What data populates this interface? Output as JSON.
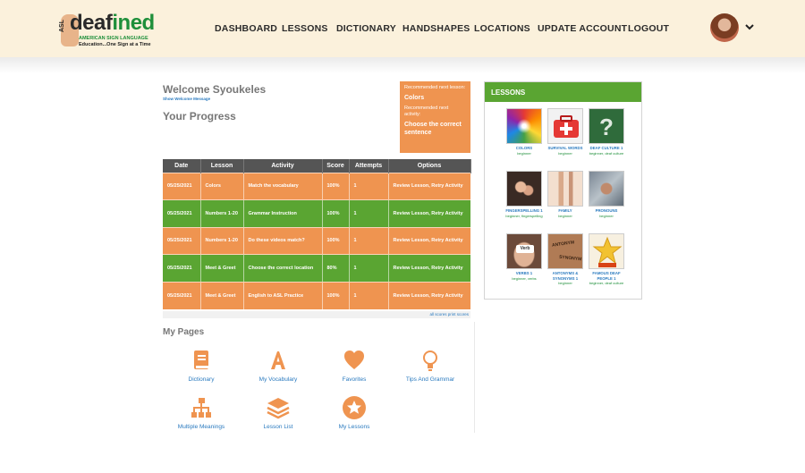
{
  "header": {
    "logo": {
      "asl": "ASL",
      "word_main": "deaf",
      "word_accent": "ined",
      "tagline1": "AMERICAN SIGN LANGUAGE",
      "tagline2": "Education...One Sign at a Time"
    },
    "nav": [
      "DASHBOARD",
      "LESSONS",
      "DICTIONARY",
      "HANDSHAPES",
      "LOCATIONS",
      "UPDATE ACCOUNT",
      "LOGOUT"
    ],
    "chevron": "⌄"
  },
  "welcome": {
    "title": "Welcome Syoukeles",
    "show_link": "Show Welcome Message",
    "progress_title": "Your Progress"
  },
  "recommend": {
    "lesson_label": "Recommended next lesson:",
    "lesson_value": "Colors",
    "activity_label": "Recommended next activity:",
    "activity_value": "Choose the correct sentence"
  },
  "table": {
    "headers": [
      "Date",
      "Lesson",
      "Activity",
      "Score",
      "Attempts",
      "Options"
    ],
    "rows": [
      {
        "date": "05/25/2021",
        "lesson": "Colors",
        "activity": "Match the vocabulary",
        "score": "100%",
        "attempts": "1",
        "options": "Review Lesson, Retry Activity"
      },
      {
        "date": "05/25/2021",
        "lesson": "Numbers 1-20",
        "activity": "Grammar Instruction",
        "score": "100%",
        "attempts": "1",
        "options": "Review Lesson, Retry Activity"
      },
      {
        "date": "05/25/2021",
        "lesson": "Numbers 1-20",
        "activity": "Do these videos match?",
        "score": "100%",
        "attempts": "1",
        "options": "Review Lesson, Retry Activity"
      },
      {
        "date": "05/25/2021",
        "lesson": "Meet & Greet",
        "activity": "Choose the correct location",
        "score": "80%",
        "attempts": "1",
        "options": "Review Lesson, Retry Activity"
      },
      {
        "date": "05/25/2021",
        "lesson": "Meet & Greet",
        "activity": "English to ASL Practice",
        "score": "100%",
        "attempts": "1",
        "options": "Review Lesson, Retry Activity"
      }
    ],
    "footer": "all scores   print scores"
  },
  "my_pages": {
    "title": "My Pages",
    "items": [
      {
        "label": "Dictionary",
        "icon": "book-icon"
      },
      {
        "label": "My Vocabulary",
        "icon": "letter-a-icon"
      },
      {
        "label": "Favorites",
        "icon": "heart-icon"
      },
      {
        "label": "Tips And Grammar",
        "icon": "lightbulb-icon"
      },
      {
        "label": "Multiple Meanings",
        "icon": "hierarchy-icon"
      },
      {
        "label": "Lesson List",
        "icon": "layers-icon"
      },
      {
        "label": "My Lessons",
        "icon": "star-badge-icon"
      }
    ]
  },
  "lessons_panel": {
    "title": "LESSONS",
    "items": [
      {
        "title": "COLORS",
        "level": "beginner"
      },
      {
        "title": "SURVIVAL WORDS",
        "level": "beginner"
      },
      {
        "title": "DEAF CULTURE 1",
        "level": "beginner, deaf culture"
      },
      {
        "title": "FINGERSPELLING 1",
        "level": "beginner, fingerspelling"
      },
      {
        "title": "FAMILY",
        "level": "beginner"
      },
      {
        "title": "PRONOUNS",
        "level": "beginner"
      },
      {
        "title": "VERBS 1",
        "level": "beginner, verbs"
      },
      {
        "title": "ANTONYMS & SYNONYMS 1",
        "level": "beginner"
      },
      {
        "title": "FAMOUS DEAF PEOPLE 1",
        "level": "beginner, deaf culture"
      }
    ],
    "thumb_text": {
      "question": "?",
      "verb": "Verb",
      "antonym": "ANTONYM",
      "synonym": "SYNONYM"
    }
  },
  "colors": {
    "orange": "#ef9450",
    "green": "#5aa532",
    "header_bg": "#fbf1dc",
    "link": "#2a7abf"
  }
}
